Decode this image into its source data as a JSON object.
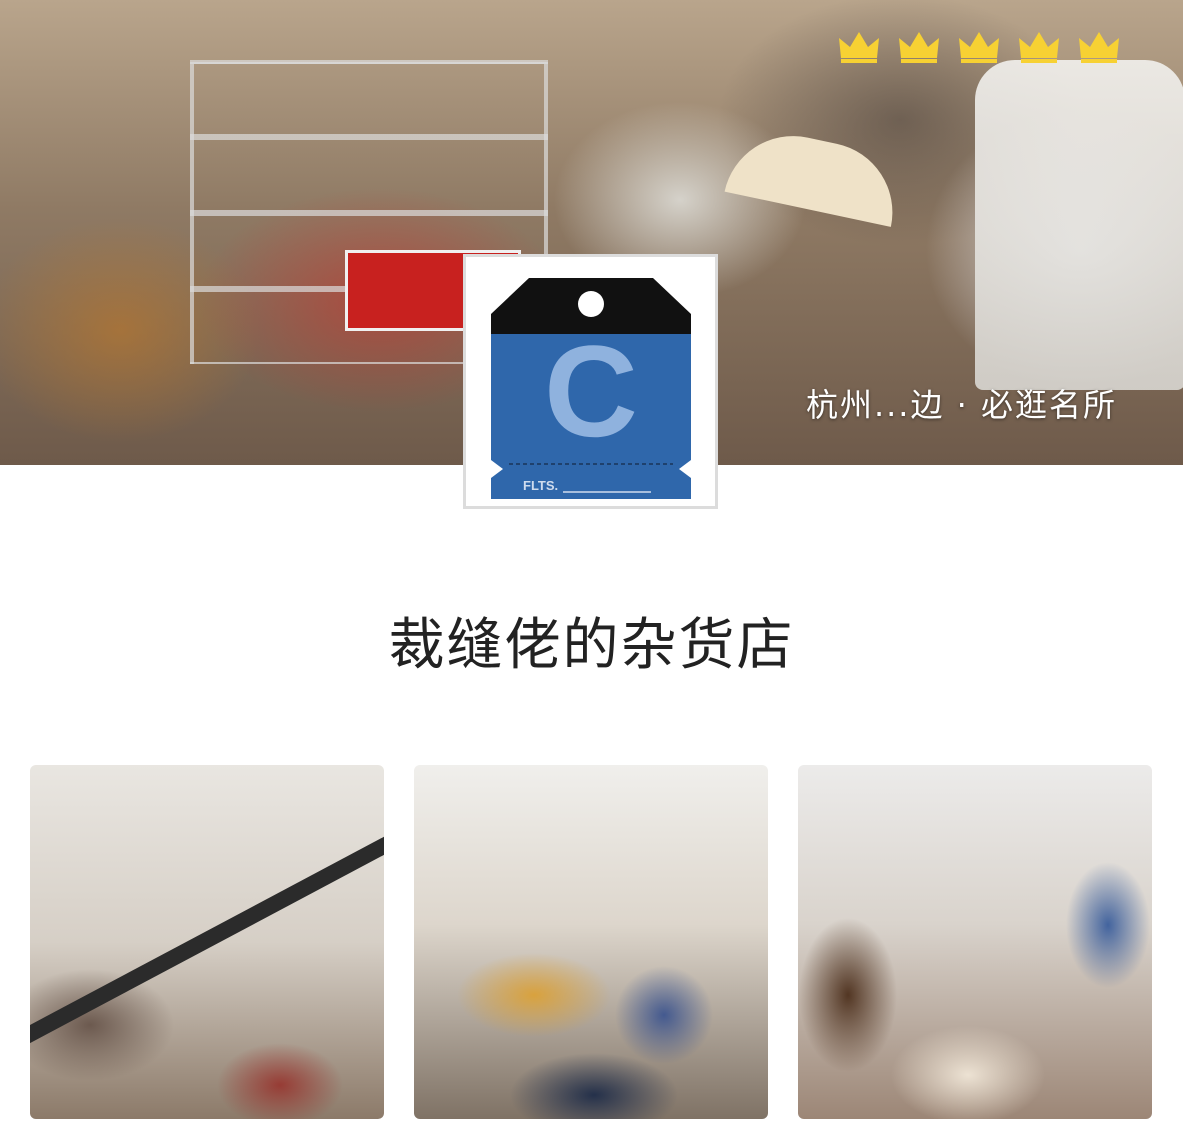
{
  "header": {
    "caption": "杭州...边 · 必逛名所",
    "rating": {
      "stars": 5,
      "icon": "crown-icon",
      "color": "#f7d133"
    }
  },
  "logo": {
    "letter": "C",
    "tag_text": "FLTS.",
    "colors": {
      "tag_blue": "#2f67ab",
      "tag_black": "#111111",
      "letter": "#8fb2de"
    }
  },
  "shop": {
    "name": "裁缝佬的杂货店"
  },
  "gallery": {
    "photos": [
      {
        "alt_icon": "photo-icon"
      },
      {
        "alt_icon": "photo-icon"
      },
      {
        "alt_icon": "photo-icon"
      }
    ]
  }
}
